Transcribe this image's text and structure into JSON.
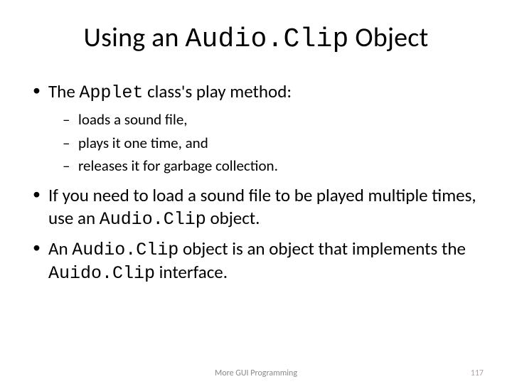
{
  "title": {
    "pre": "Using an ",
    "code": "Audio.Clip",
    "post": " Object"
  },
  "bullets": {
    "b1": {
      "pre": "The ",
      "code": "Applet",
      "post": " class's play method:"
    },
    "sub": {
      "s1": "loads a sound file,",
      "s2": "plays it one time, and",
      "s3": "releases it for garbage collection."
    },
    "b2": {
      "pre": "If you need to load a sound file to be played multiple times, use an ",
      "code": "Audio.Clip",
      "post": " object."
    },
    "b3": {
      "pre": "An ",
      "code1": "Audio.Clip",
      "mid": " object is an object that implements the ",
      "code2": "Auido.Clip",
      "post": " interface."
    }
  },
  "footer": {
    "center": "More GUI Programming",
    "page": "117"
  }
}
